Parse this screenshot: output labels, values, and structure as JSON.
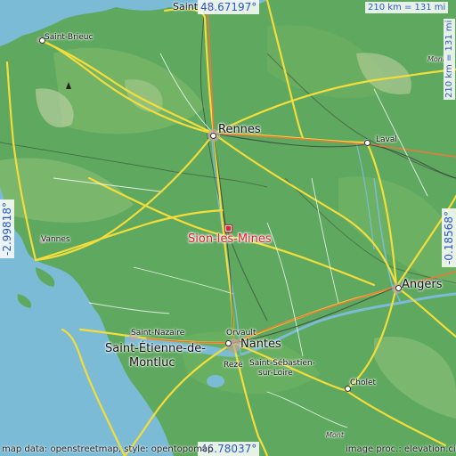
{
  "map": {
    "colors": {
      "sea": "#7bbbd6",
      "land": "#5fa860",
      "target": "#e0202a",
      "coord_text": "#2a57c8"
    },
    "target": {
      "name": "Sion-les-Mines"
    },
    "coords": {
      "top": "48.67197°",
      "bottom": "46.78037°",
      "left": "-2.99818°",
      "right": "-0.18568°"
    },
    "scale": {
      "horizontal": "210 km = 131 mi",
      "vertical": "210 km = 131 mi"
    },
    "attribution_left": "map data: openstreetmap, style: opentopomap",
    "attribution_right": "image proc.: elevation.city",
    "places": {
      "saint_malo": "Saint-Ma",
      "saint_brieuc": "Saint-Brieuc",
      "rennes": "Rennes",
      "laval": "Laval",
      "vannes": "Vannes",
      "angers": "Angers",
      "saint_nazaire": "Saint-Nazaire",
      "saint_etienne": "Saint-Étienne-de-",
      "montluc": "Montluc",
      "orvault": "Orvault",
      "nantes": "Nantes",
      "reze": "Rezé",
      "saint_sebastien": "Saint-Sébastien-",
      "sur_loire": "sur-Loire",
      "cholet": "Cholet",
      "mont": "Mont",
      "moni": "Moni"
    }
  }
}
